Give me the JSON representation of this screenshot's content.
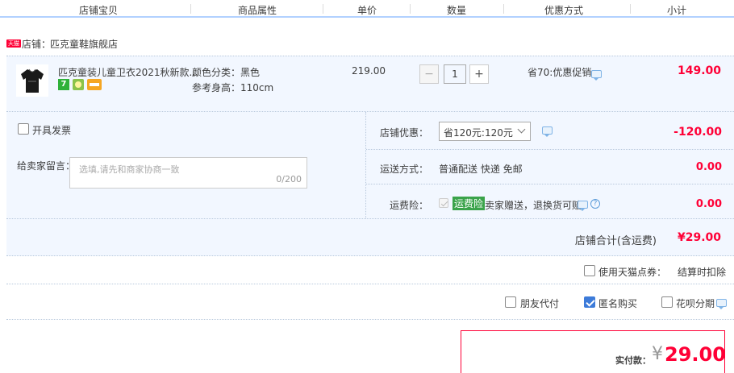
{
  "header": {
    "columns": [
      "店铺宝贝",
      "商品属性",
      "单价",
      "数量",
      "优惠方式",
      "小计"
    ]
  },
  "shop": {
    "badge": "天猫",
    "label": "店铺：",
    "name": "匹克童鞋旗舰店"
  },
  "item": {
    "title": "匹克童装儿童卫衣2021秋新款...",
    "attr_color": "颜色分类：黑色",
    "attr_size": "参考身高：110cm",
    "price": "219.00",
    "quantity": "1",
    "minus": "−",
    "plus": "+",
    "promo": "省70:优惠促销",
    "subtotal": "149.00",
    "badge_7": "7"
  },
  "options": {
    "invoice_label": "开具发票",
    "message_label": "给卖家留言：",
    "message_placeholder": "选填,请先和商家协商一致",
    "message_count": "0/200",
    "shop_discount_label": "店铺优惠：",
    "shop_discount_value": "省120元:120元",
    "shop_discount_amount": "-120.00",
    "shipping_label": "运送方式：",
    "shipping_value": "普通配送 快递 免邮",
    "shipping_amount": "0.00",
    "insurance_label": "运费险：",
    "insurance_tag": "运费险",
    "insurance_text": "卖家赠送，退换货可赔",
    "insurance_amount": "0.00"
  },
  "shop_total": {
    "label": "店铺合计(含运费)",
    "value": "¥29.00"
  },
  "points": {
    "label": "使用天猫点券：",
    "note": "结算时扣除"
  },
  "extra_options": {
    "friend_pay": "朋友代付",
    "anonymous": "匿名购买",
    "huabei": "花呗分期"
  },
  "pay": {
    "label": "实付款：",
    "currency": "¥",
    "amount": "29.00"
  },
  "colors": {
    "accent_red": "#ff0036",
    "light_blue_bg": "#f2f7ff",
    "header_border": "#b2d1ff"
  }
}
